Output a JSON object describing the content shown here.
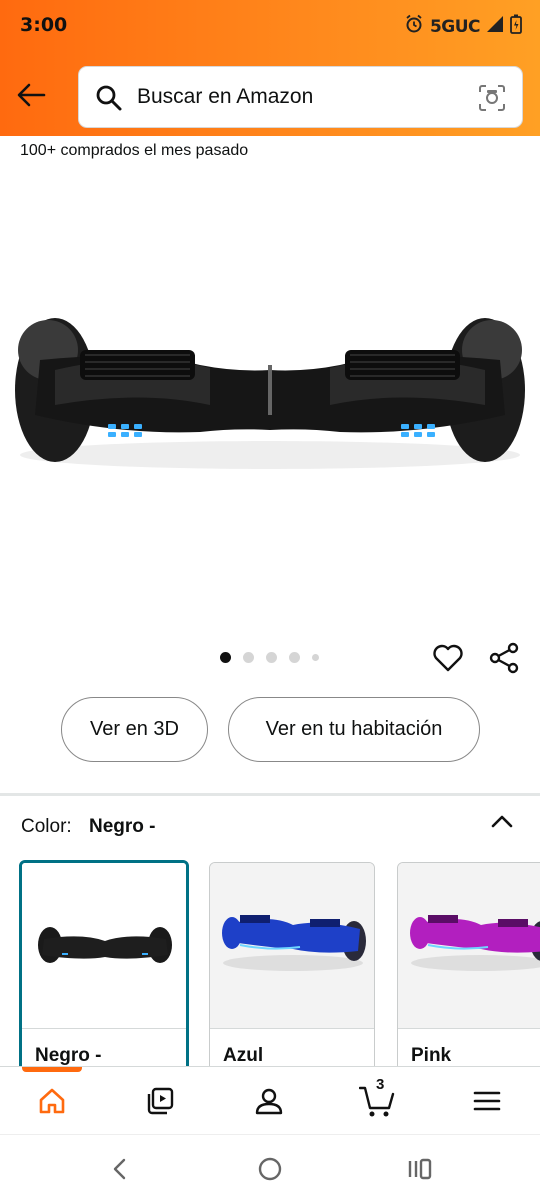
{
  "status": {
    "time": "3:00",
    "network": "5GUC"
  },
  "search": {
    "placeholder": "Buscar en Amazon"
  },
  "product": {
    "purchased_text": "100+ comprados el mes pasado",
    "image_count": 5,
    "active_image": 1
  },
  "actions": {
    "view_3d": "Ver en 3D",
    "view_room": "Ver en tu habitación"
  },
  "variant": {
    "label": "Color:",
    "selected": "Negro -",
    "options": [
      {
        "name": "Negro -",
        "color": "#1a1a1a"
      },
      {
        "name": "Azul",
        "color": "#1e40c8"
      },
      {
        "name": "Pink",
        "color": "#b21fbf"
      }
    ]
  },
  "bottom_nav": {
    "items": [
      "home-icon",
      "video-icon",
      "account-icon",
      "cart-icon",
      "menu-icon"
    ],
    "cart_count": "3"
  },
  "colors": {
    "accent": "#ff6a0f",
    "selected_border": "#007185"
  }
}
